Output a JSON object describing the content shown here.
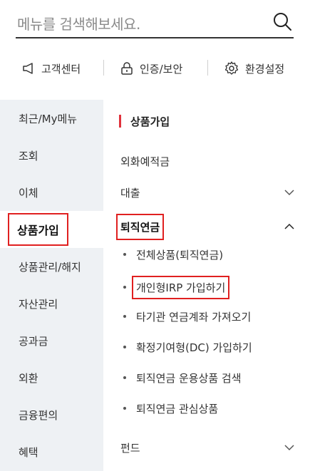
{
  "search": {
    "placeholder": "메뉴를 검색해보세요."
  },
  "utility": [
    {
      "label": "고객센터",
      "icon": "megaphone-icon"
    },
    {
      "label": "인증/보안",
      "icon": "lock-icon"
    },
    {
      "label": "환경설정",
      "icon": "gear-icon"
    }
  ],
  "left_nav": {
    "items": [
      {
        "label": "최근/My메뉴"
      },
      {
        "label": "조회"
      },
      {
        "label": "이체"
      },
      {
        "label": "상품가입"
      },
      {
        "label": "상품관리/해지"
      },
      {
        "label": "자산관리"
      },
      {
        "label": "공과금"
      },
      {
        "label": "외환"
      },
      {
        "label": "금융편의"
      },
      {
        "label": "혜택"
      }
    ],
    "active_index": 3
  },
  "right_panel": {
    "title": "상품가입",
    "items": [
      {
        "label": "외화예적금"
      },
      {
        "label": "대출",
        "icon": "chevron-down-icon"
      },
      {
        "label": "퇴직연금",
        "icon": "chevron-up-icon"
      },
      {
        "label": "펀드",
        "icon": "chevron-down-icon"
      }
    ],
    "sub_items": [
      {
        "label": "전체상품(퇴직연금)"
      },
      {
        "label": "개인형IRP 가입하기"
      },
      {
        "label": "타기관 연금계좌 가져오기"
      },
      {
        "label": "확정기여형(DC) 가입하기"
      },
      {
        "label": "퇴직연금 운용상품 검색"
      },
      {
        "label": "퇴직연금 관심상품"
      }
    ]
  },
  "colors": {
    "accent": "#e0323c",
    "highlight_box": "#e02020",
    "nav_bg": "#eef1f4"
  }
}
